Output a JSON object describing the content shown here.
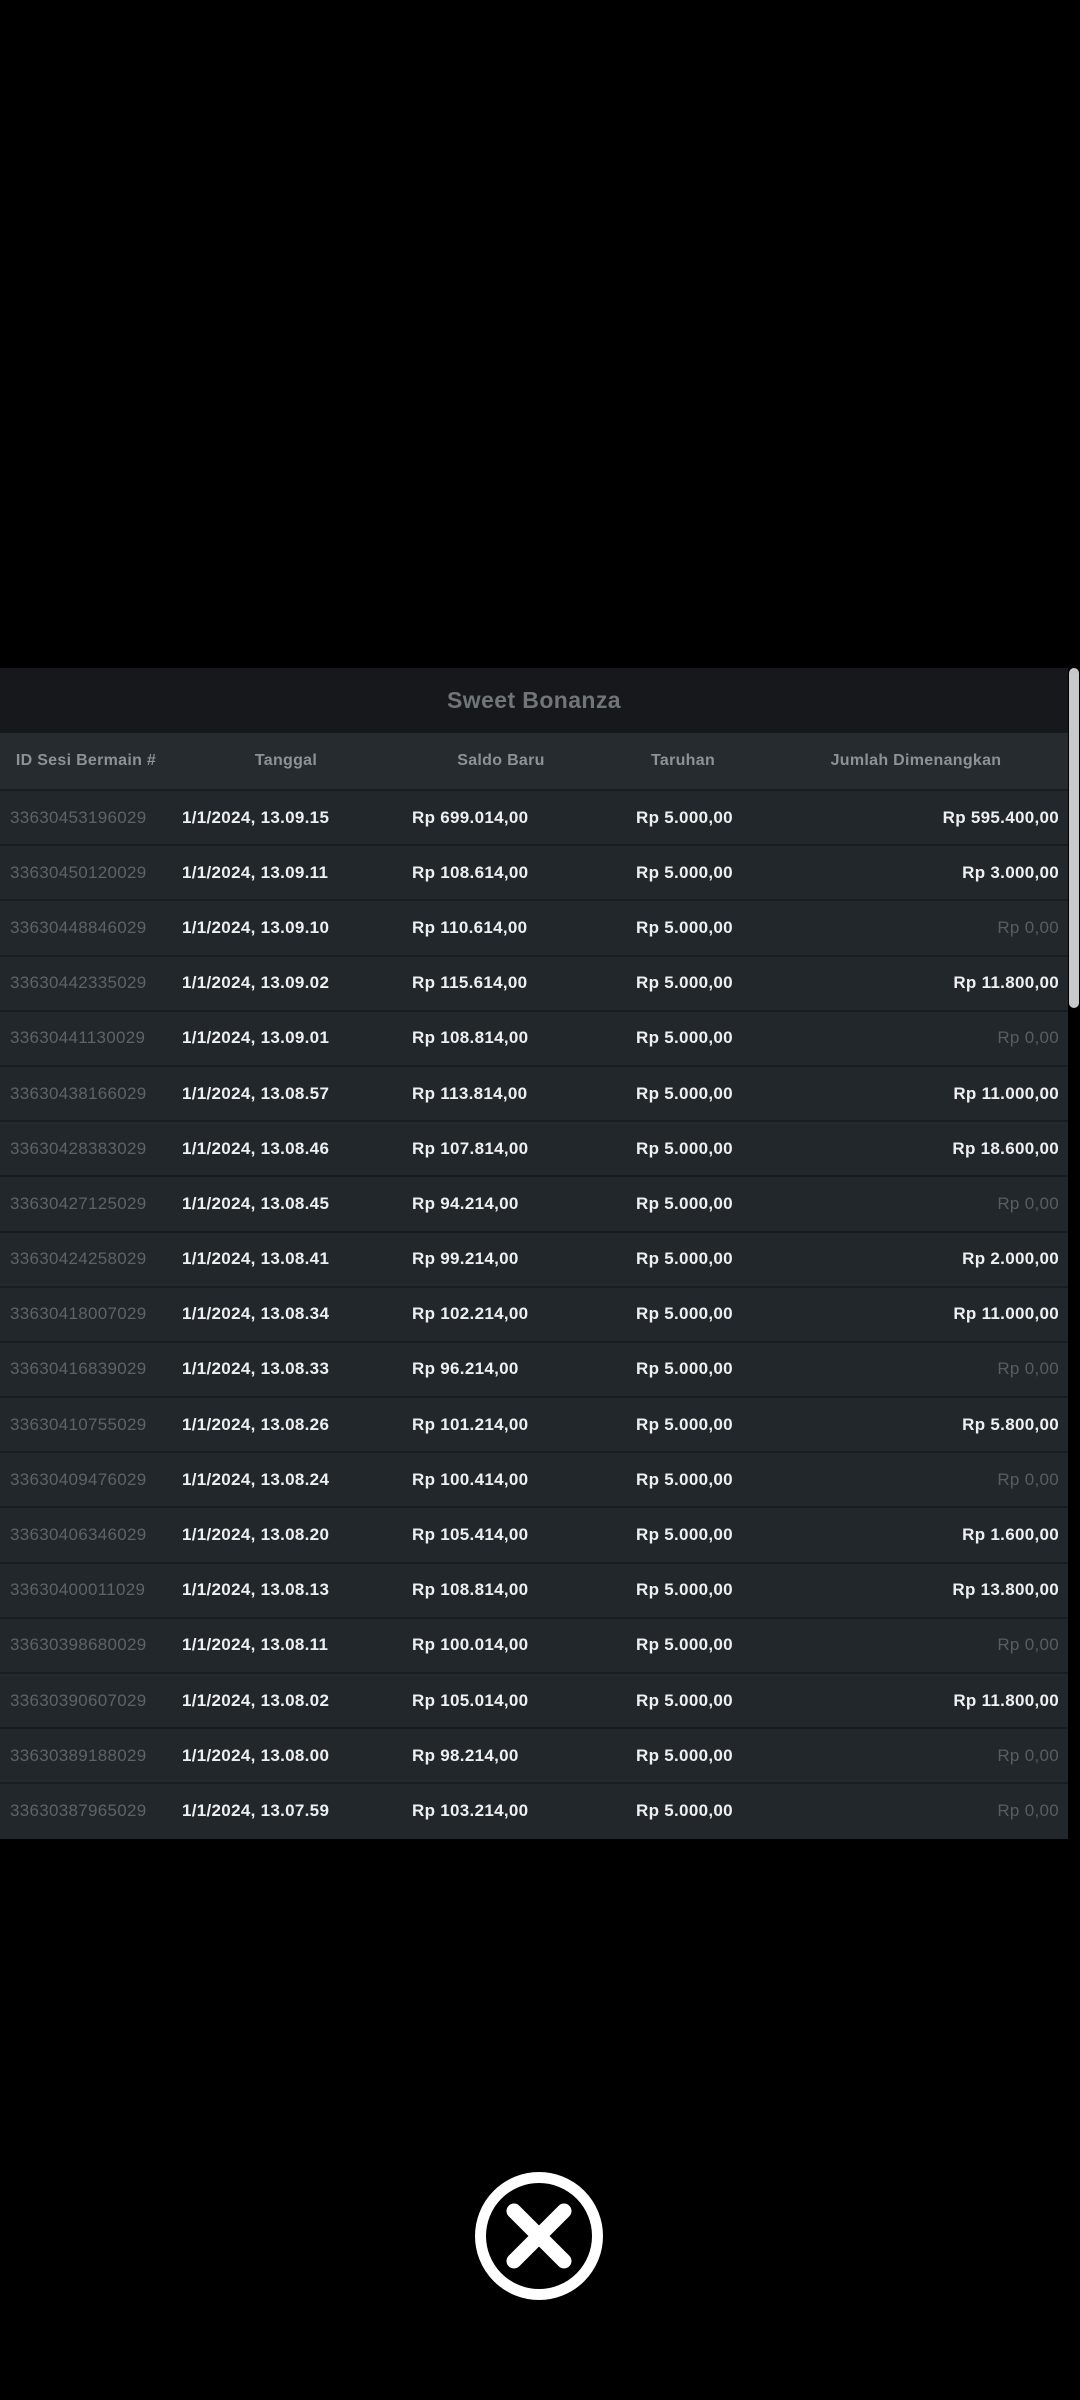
{
  "modal": {
    "title": "Sweet Bonanza",
    "columns": [
      {
        "key": "id",
        "label": "ID Sesi Bermain #"
      },
      {
        "key": "date",
        "label": "Tanggal"
      },
      {
        "key": "balance",
        "label": "Saldo Baru"
      },
      {
        "key": "bet",
        "label": "Taruhan"
      },
      {
        "key": "win",
        "label": "Jumlah Dimenangkan"
      }
    ],
    "rows": [
      {
        "id": "33630453196029",
        "date": "1/1/2024, 13.09.15",
        "balance": "Rp 699.014,00",
        "bet": "Rp 5.000,00",
        "win": "Rp 595.400,00",
        "win_dim": false
      },
      {
        "id": "33630450120029",
        "date": "1/1/2024, 13.09.11",
        "balance": "Rp 108.614,00",
        "bet": "Rp 5.000,00",
        "win": "Rp 3.000,00",
        "win_dim": false
      },
      {
        "id": "33630448846029",
        "date": "1/1/2024, 13.09.10",
        "balance": "Rp 110.614,00",
        "bet": "Rp 5.000,00",
        "win": "Rp 0,00",
        "win_dim": true
      },
      {
        "id": "33630442335029",
        "date": "1/1/2024, 13.09.02",
        "balance": "Rp 115.614,00",
        "bet": "Rp 5.000,00",
        "win": "Rp 11.800,00",
        "win_dim": false
      },
      {
        "id": "33630441130029",
        "date": "1/1/2024, 13.09.01",
        "balance": "Rp 108.814,00",
        "bet": "Rp 5.000,00",
        "win": "Rp 0,00",
        "win_dim": true
      },
      {
        "id": "33630438166029",
        "date": "1/1/2024, 13.08.57",
        "balance": "Rp 113.814,00",
        "bet": "Rp 5.000,00",
        "win": "Rp 11.000,00",
        "win_dim": false
      },
      {
        "id": "33630428383029",
        "date": "1/1/2024, 13.08.46",
        "balance": "Rp 107.814,00",
        "bet": "Rp 5.000,00",
        "win": "Rp 18.600,00",
        "win_dim": false
      },
      {
        "id": "33630427125029",
        "date": "1/1/2024, 13.08.45",
        "balance": "Rp 94.214,00",
        "bet": "Rp 5.000,00",
        "win": "Rp 0,00",
        "win_dim": true
      },
      {
        "id": "33630424258029",
        "date": "1/1/2024, 13.08.41",
        "balance": "Rp 99.214,00",
        "bet": "Rp 5.000,00",
        "win": "Rp 2.000,00",
        "win_dim": false
      },
      {
        "id": "33630418007029",
        "date": "1/1/2024, 13.08.34",
        "balance": "Rp 102.214,00",
        "bet": "Rp 5.000,00",
        "win": "Rp 11.000,00",
        "win_dim": false
      },
      {
        "id": "33630416839029",
        "date": "1/1/2024, 13.08.33",
        "balance": "Rp 96.214,00",
        "bet": "Rp 5.000,00",
        "win": "Rp 0,00",
        "win_dim": true
      },
      {
        "id": "33630410755029",
        "date": "1/1/2024, 13.08.26",
        "balance": "Rp 101.214,00",
        "bet": "Rp 5.000,00",
        "win": "Rp 5.800,00",
        "win_dim": false
      },
      {
        "id": "33630409476029",
        "date": "1/1/2024, 13.08.24",
        "balance": "Rp 100.414,00",
        "bet": "Rp 5.000,00",
        "win": "Rp 0,00",
        "win_dim": true
      },
      {
        "id": "33630406346029",
        "date": "1/1/2024, 13.08.20",
        "balance": "Rp 105.414,00",
        "bet": "Rp 5.000,00",
        "win": "Rp 1.600,00",
        "win_dim": false
      },
      {
        "id": "33630400011029",
        "date": "1/1/2024, 13.08.13",
        "balance": "Rp 108.814,00",
        "bet": "Rp 5.000,00",
        "win": "Rp 13.800,00",
        "win_dim": false
      },
      {
        "id": "33630398680029",
        "date": "1/1/2024, 13.08.11",
        "balance": "Rp 100.014,00",
        "bet": "Rp 5.000,00",
        "win": "Rp 0,00",
        "win_dim": true
      },
      {
        "id": "33630390607029",
        "date": "1/1/2024, 13.08.02",
        "balance": "Rp 105.014,00",
        "bet": "Rp 5.000,00",
        "win": "Rp 11.800,00",
        "win_dim": false
      },
      {
        "id": "33630389188029",
        "date": "1/1/2024, 13.08.00",
        "balance": "Rp 98.214,00",
        "bet": "Rp 5.000,00",
        "win": "Rp 0,00",
        "win_dim": true
      },
      {
        "id": "33630387965029",
        "date": "1/1/2024, 13.07.59",
        "balance": "Rp 103.214,00",
        "bet": "Rp 5.000,00",
        "win": "Rp 0,00",
        "win_dim": true
      }
    ]
  },
  "close_button": {
    "icon": "x-circle"
  },
  "colors": {
    "page_background": "#000000",
    "panel_background": "#22272b",
    "title_bar_background": "#16181b",
    "header_background": "#262b2f",
    "row_divider": "#191d20",
    "title_text": "#70757a",
    "header_text": "#8c9296",
    "id_text": "#5d6367",
    "value_text": "#edeff0",
    "zero_value_text": "#575d61",
    "scrollbar_thumb": "#c7c9cb",
    "close_icon": "#ffffff"
  }
}
